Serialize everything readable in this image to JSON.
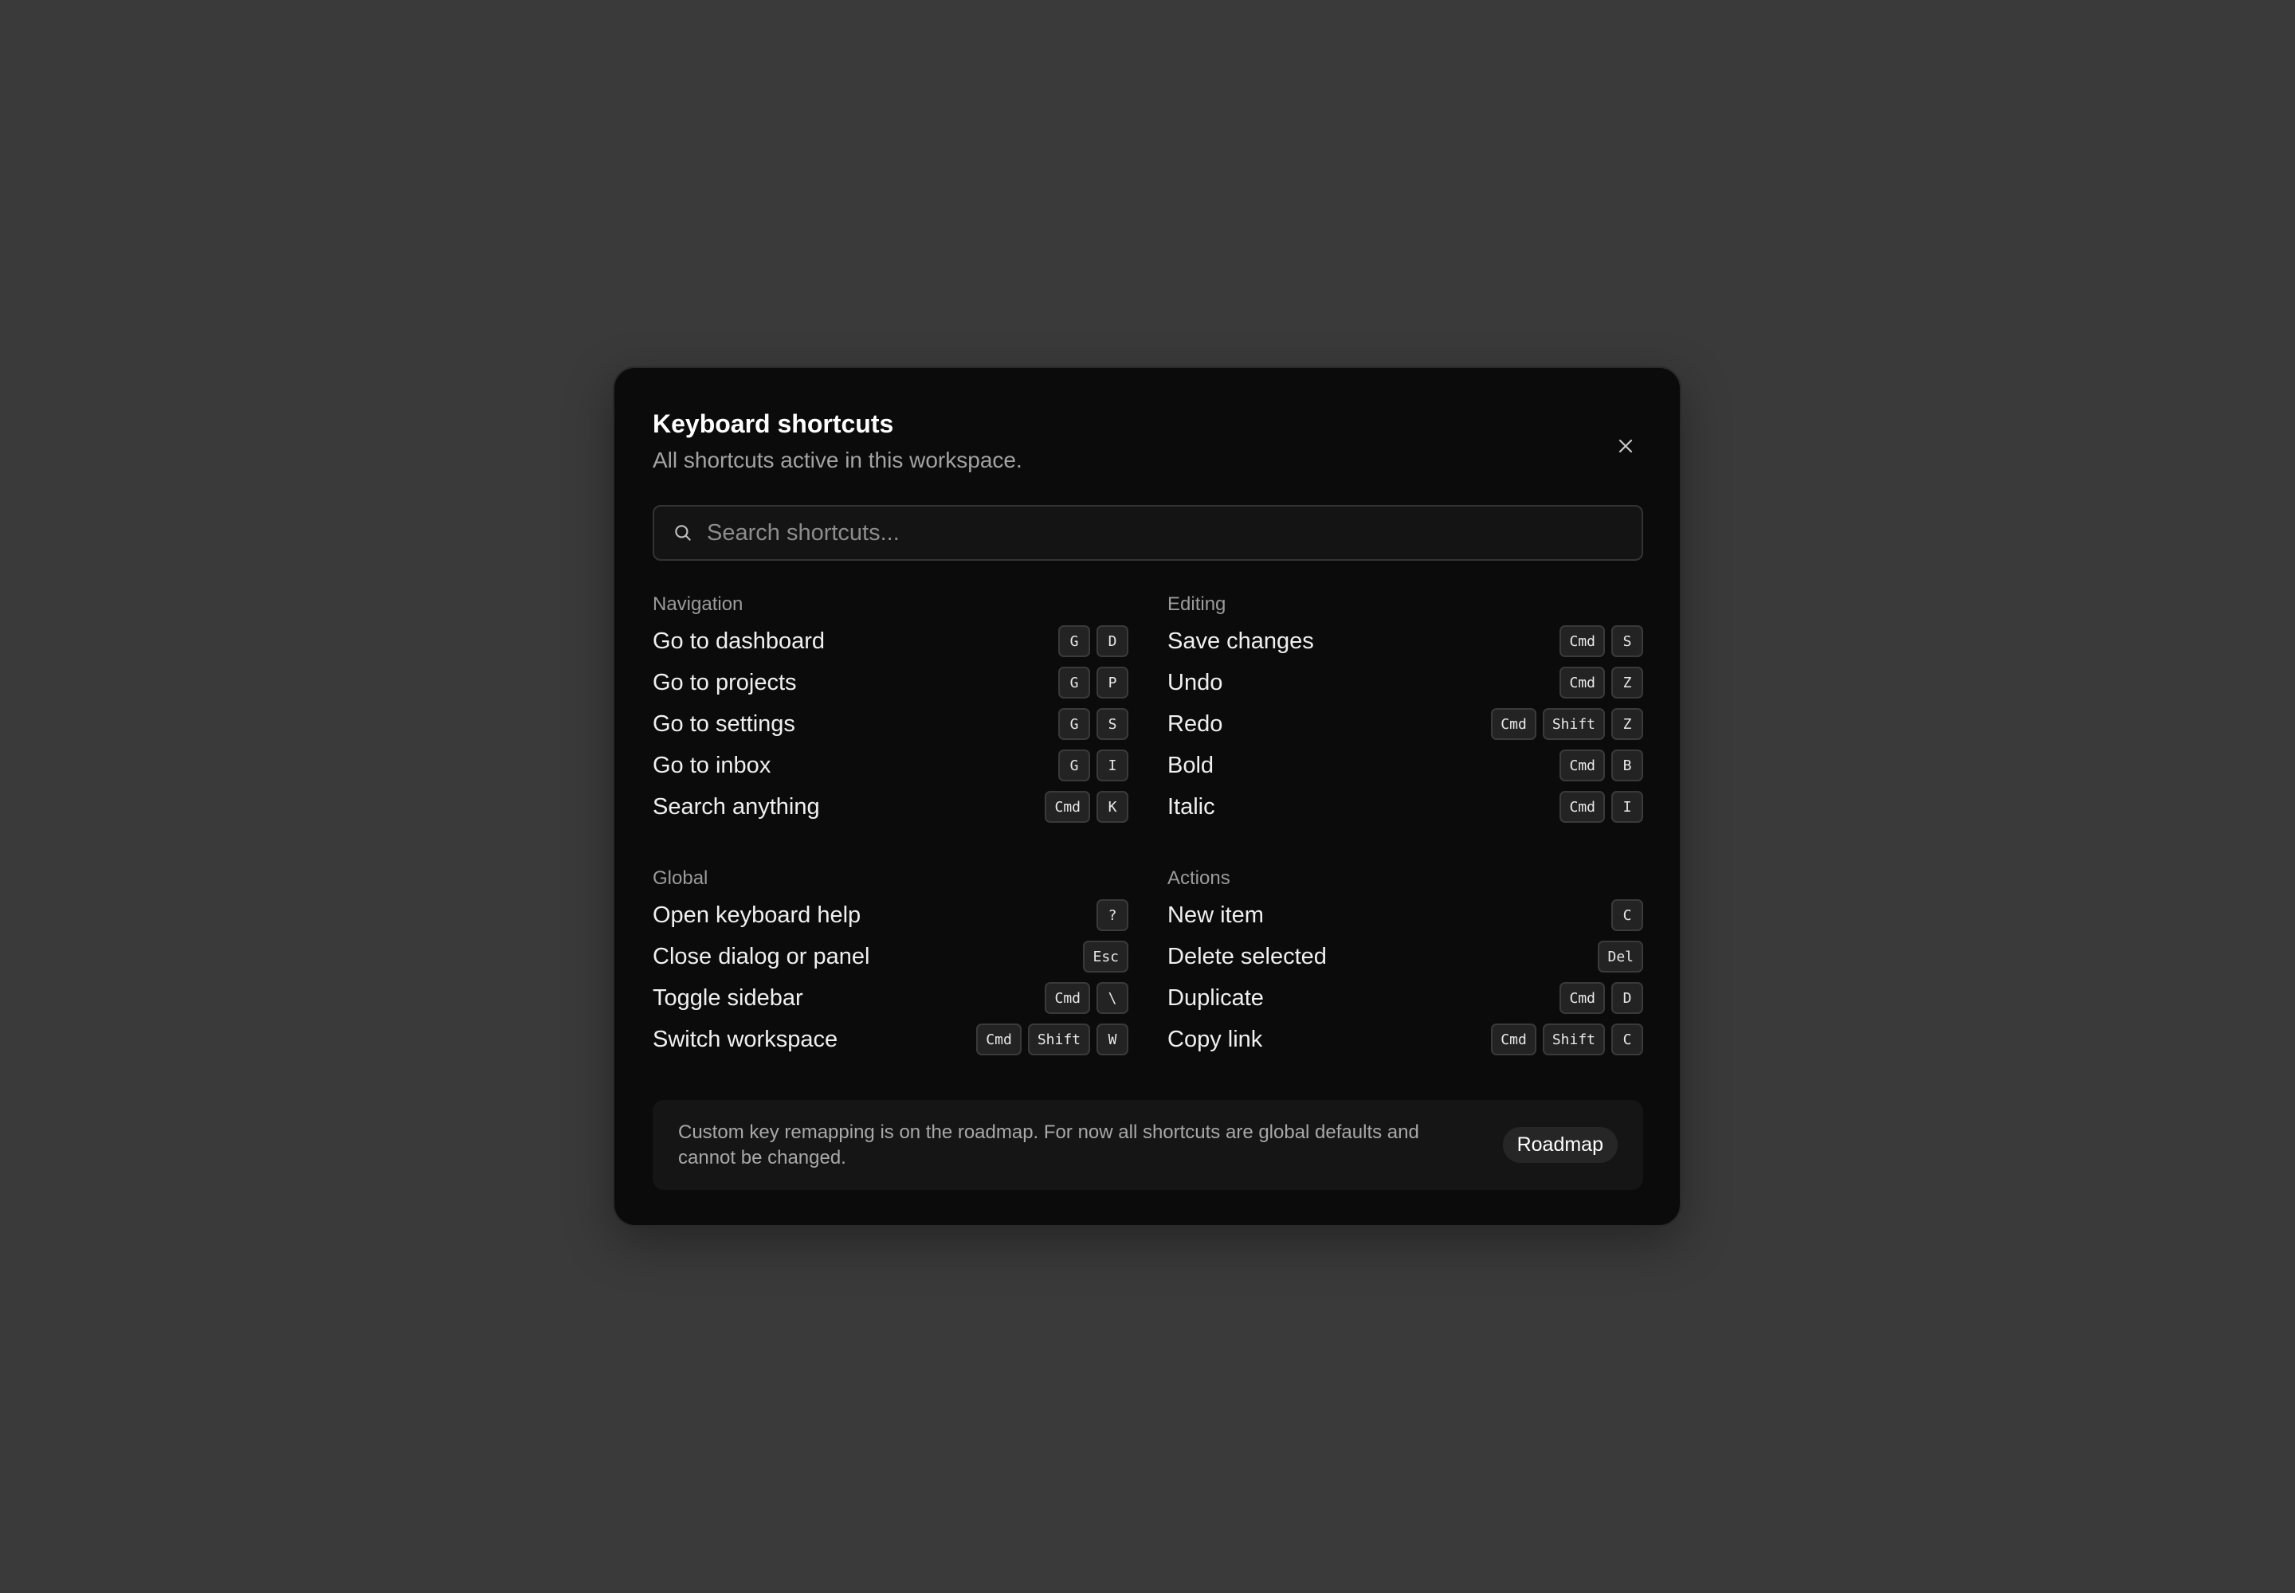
{
  "dialog": {
    "title": "Keyboard shortcuts",
    "subtitle": "All shortcuts active in this workspace.",
    "close_icon": "close-icon"
  },
  "search": {
    "icon": "search-icon",
    "placeholder": "Search shortcuts...",
    "value": ""
  },
  "sections": [
    {
      "title": "Navigation",
      "items": [
        {
          "label": "Go to dashboard",
          "keys": [
            "G",
            "D"
          ]
        },
        {
          "label": "Go to projects",
          "keys": [
            "G",
            "P"
          ]
        },
        {
          "label": "Go to settings",
          "keys": [
            "G",
            "S"
          ]
        },
        {
          "label": "Go to inbox",
          "keys": [
            "G",
            "I"
          ]
        },
        {
          "label": "Search anything",
          "keys": [
            "Cmd",
            "K"
          ]
        }
      ]
    },
    {
      "title": "Editing",
      "items": [
        {
          "label": "Save changes",
          "keys": [
            "Cmd",
            "S"
          ]
        },
        {
          "label": "Undo",
          "keys": [
            "Cmd",
            "Z"
          ]
        },
        {
          "label": "Redo",
          "keys": [
            "Cmd",
            "Shift",
            "Z"
          ]
        },
        {
          "label": "Bold",
          "keys": [
            "Cmd",
            "B"
          ]
        },
        {
          "label": "Italic",
          "keys": [
            "Cmd",
            "I"
          ]
        }
      ]
    },
    {
      "title": "Global",
      "items": [
        {
          "label": "Open keyboard help",
          "keys": [
            "?"
          ]
        },
        {
          "label": "Close dialog or panel",
          "keys": [
            "Esc"
          ]
        },
        {
          "label": "Toggle sidebar",
          "keys": [
            "Cmd",
            "\\"
          ]
        },
        {
          "label": "Switch workspace",
          "keys": [
            "Cmd",
            "Shift",
            "W"
          ]
        }
      ]
    },
    {
      "title": "Actions",
      "items": [
        {
          "label": "New item",
          "keys": [
            "C"
          ]
        },
        {
          "label": "Delete selected",
          "keys": [
            "Del"
          ]
        },
        {
          "label": "Duplicate",
          "keys": [
            "Cmd",
            "D"
          ]
        },
        {
          "label": "Copy link",
          "keys": [
            "Cmd",
            "Shift",
            "C"
          ]
        }
      ]
    }
  ],
  "footer": {
    "text": "Custom key remapping is on the roadmap. For now all shortcuts are global defaults and cannot be changed.",
    "button_label": "Roadmap"
  },
  "colors": {
    "backdrop": "#3a3a3a",
    "dialog_bg": "#0b0b0b",
    "kbd_bg": "#232323"
  }
}
